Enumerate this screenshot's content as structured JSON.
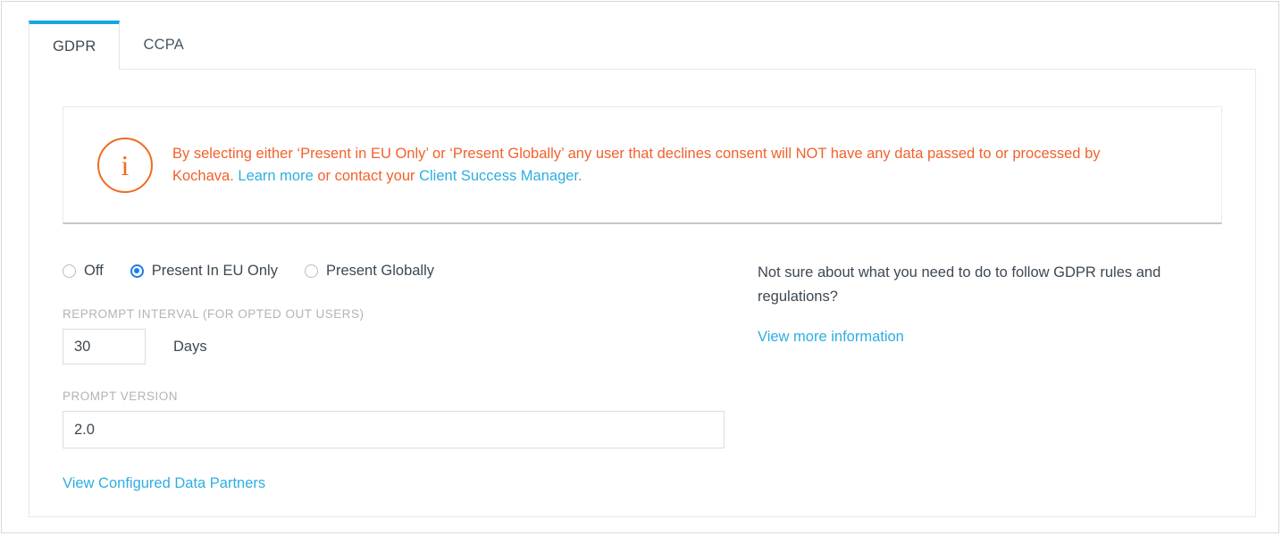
{
  "tabs": [
    {
      "label": "GDPR",
      "active": true
    },
    {
      "label": "CCPA",
      "active": false
    }
  ],
  "banner": {
    "icon": "info-icon",
    "icon_glyph": "i",
    "text_part_1": "By selecting either ‘Present in EU Only’ or ‘Present Globally’ any user that declines consent will NOT have any data passed to or processed by Kochava. ",
    "link_1": "Learn more",
    "text_part_2": " or contact your ",
    "link_2": "Client Success Manager",
    "text_part_3": ".",
    "accent_color": "#f2612c",
    "link_color": "#2eaee0"
  },
  "radio_group": {
    "options": [
      {
        "label": "Off",
        "selected": false
      },
      {
        "label": "Present In EU Only",
        "selected": true
      },
      {
        "label": "Present Globally",
        "selected": false
      }
    ],
    "selected_color": "#1a7cf0"
  },
  "reprompt": {
    "label": "REPROMPT INTERVAL (FOR OPTED OUT USERS)",
    "value": "30",
    "placeholder": "",
    "unit": "Days"
  },
  "prompt_version": {
    "label": "PROMPT VERSION",
    "value": "2.0",
    "placeholder": ""
  },
  "data_partners_link": "View Configured Data Partners",
  "help": {
    "text": "Not sure about what you need to do to follow GDPR rules and regulations?",
    "link": "View more information"
  }
}
